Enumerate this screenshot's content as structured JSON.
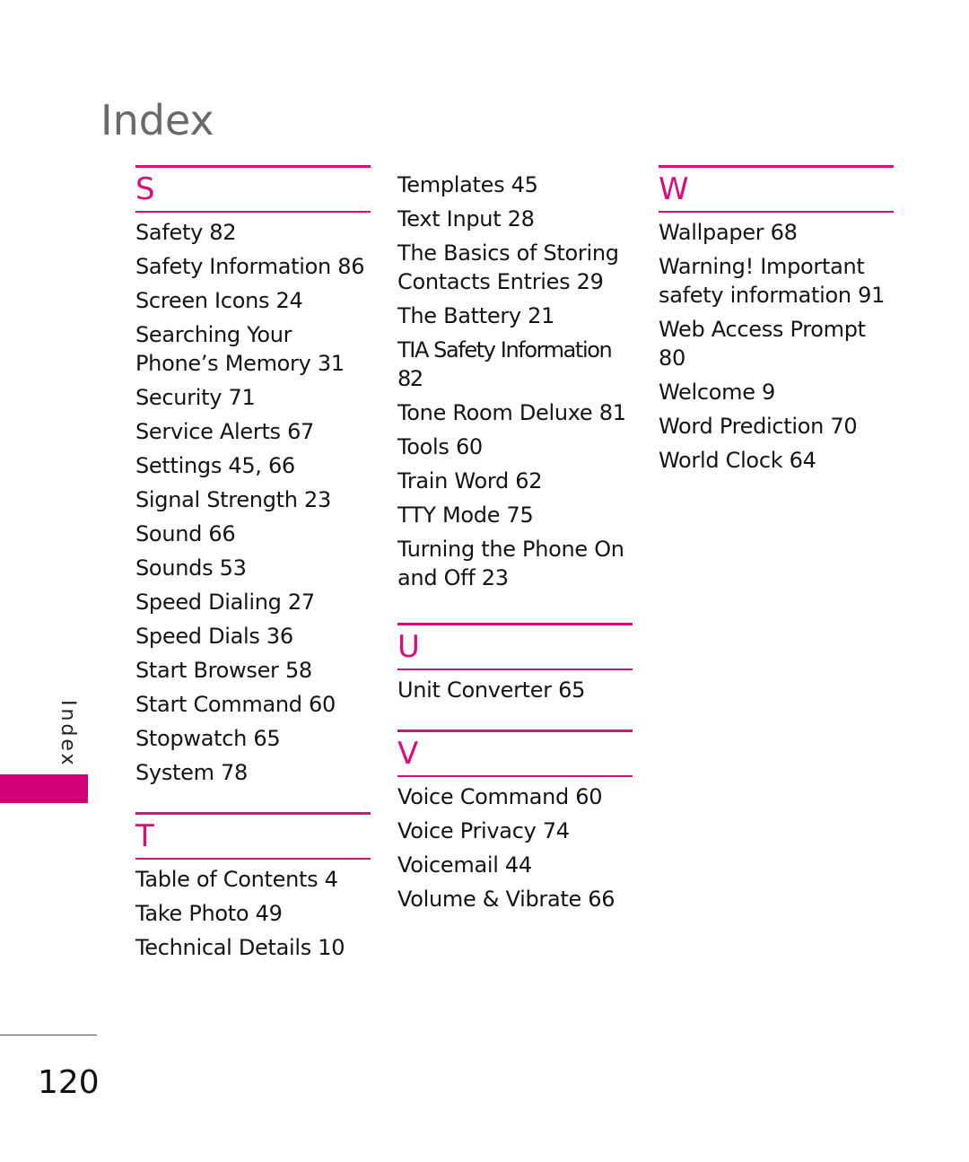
{
  "page": {
    "title": "Index",
    "side_tab_label": "Index",
    "page_number": "120",
    "accent_color": "#d4117a"
  },
  "columns": [
    {
      "sections": [
        {
          "letter": "S",
          "entries": [
            "Safety 82",
            "Safety Information 86",
            "Screen Icons 24",
            "Searching Your Phone’s Memory 31",
            "Security 71",
            "Service Alerts 67",
            "Settings 45, 66",
            "Signal Strength 23",
            "Sound 66",
            "Sounds 53",
            "Speed Dialing 27",
            "Speed Dials 36",
            "Start Browser 58",
            "Start Command 60",
            "Stopwatch 65",
            "System 78"
          ]
        },
        {
          "letter": "T",
          "entries": [
            "Table of Contents 4",
            "Take Photo 49",
            "Technical Details 10"
          ]
        }
      ]
    },
    {
      "continuation": [
        "Templates 45",
        "Text Input 28",
        "The Basics of Storing Contacts Entries 29",
        "The Battery 21",
        "TIA Safety Information 82",
        "Tone Room Deluxe 81",
        "Tools 60",
        "Train Word 62",
        "TTY Mode 75",
        "Turning the Phone On and Off 23"
      ],
      "sections": [
        {
          "letter": "U",
          "entries": [
            "Unit Converter 65"
          ]
        },
        {
          "letter": "V",
          "entries": [
            "Voice Command 60",
            "Voice Privacy 74",
            "Voicemail 44",
            "Volume & Vibrate 66"
          ]
        }
      ]
    },
    {
      "sections": [
        {
          "letter": "W",
          "entries": [
            "Wallpaper 68",
            "Warning! Important safety information 91",
            "Web Access Prompt 80",
            "Welcome 9",
            "Word Prediction 70",
            "World Clock 64"
          ]
        }
      ]
    }
  ]
}
